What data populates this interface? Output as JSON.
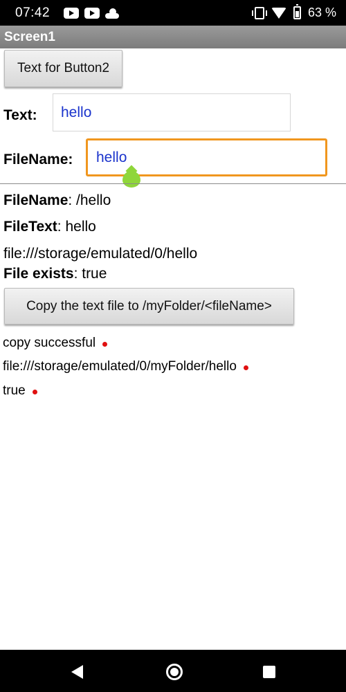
{
  "status_bar": {
    "time": "07:42",
    "battery_percent": "63 %",
    "icons": [
      "youtube-icon",
      "youtube-icon",
      "cloud-icon",
      "vibrate-icon",
      "wifi-icon",
      "battery-icon"
    ]
  },
  "app": {
    "title": "Screen1"
  },
  "top_button": {
    "label": "Text for Button2"
  },
  "text_field": {
    "label": "Text:",
    "value": "hello"
  },
  "filename_field": {
    "label": "FileName:",
    "value": "hello"
  },
  "info": {
    "filename_key": "FileName",
    "filename_value": ": /hello",
    "filetext_key": "FileText",
    "filetext_value": ": hello",
    "path": "file:///storage/emulated/0/hello",
    "exists_key": "File exists",
    "exists_value": ": true"
  },
  "copy_button": {
    "label": "Copy the text file to /myFolder/<fileName>"
  },
  "results": [
    "copy successful",
    "file:///storage/emulated/0/myFolder/hello",
    "true"
  ],
  "colors": {
    "input_text": "#1a33cc",
    "focus_border": "#f0961e",
    "cursor_handle": "#8fd63a",
    "result_dot": "#e01010"
  }
}
